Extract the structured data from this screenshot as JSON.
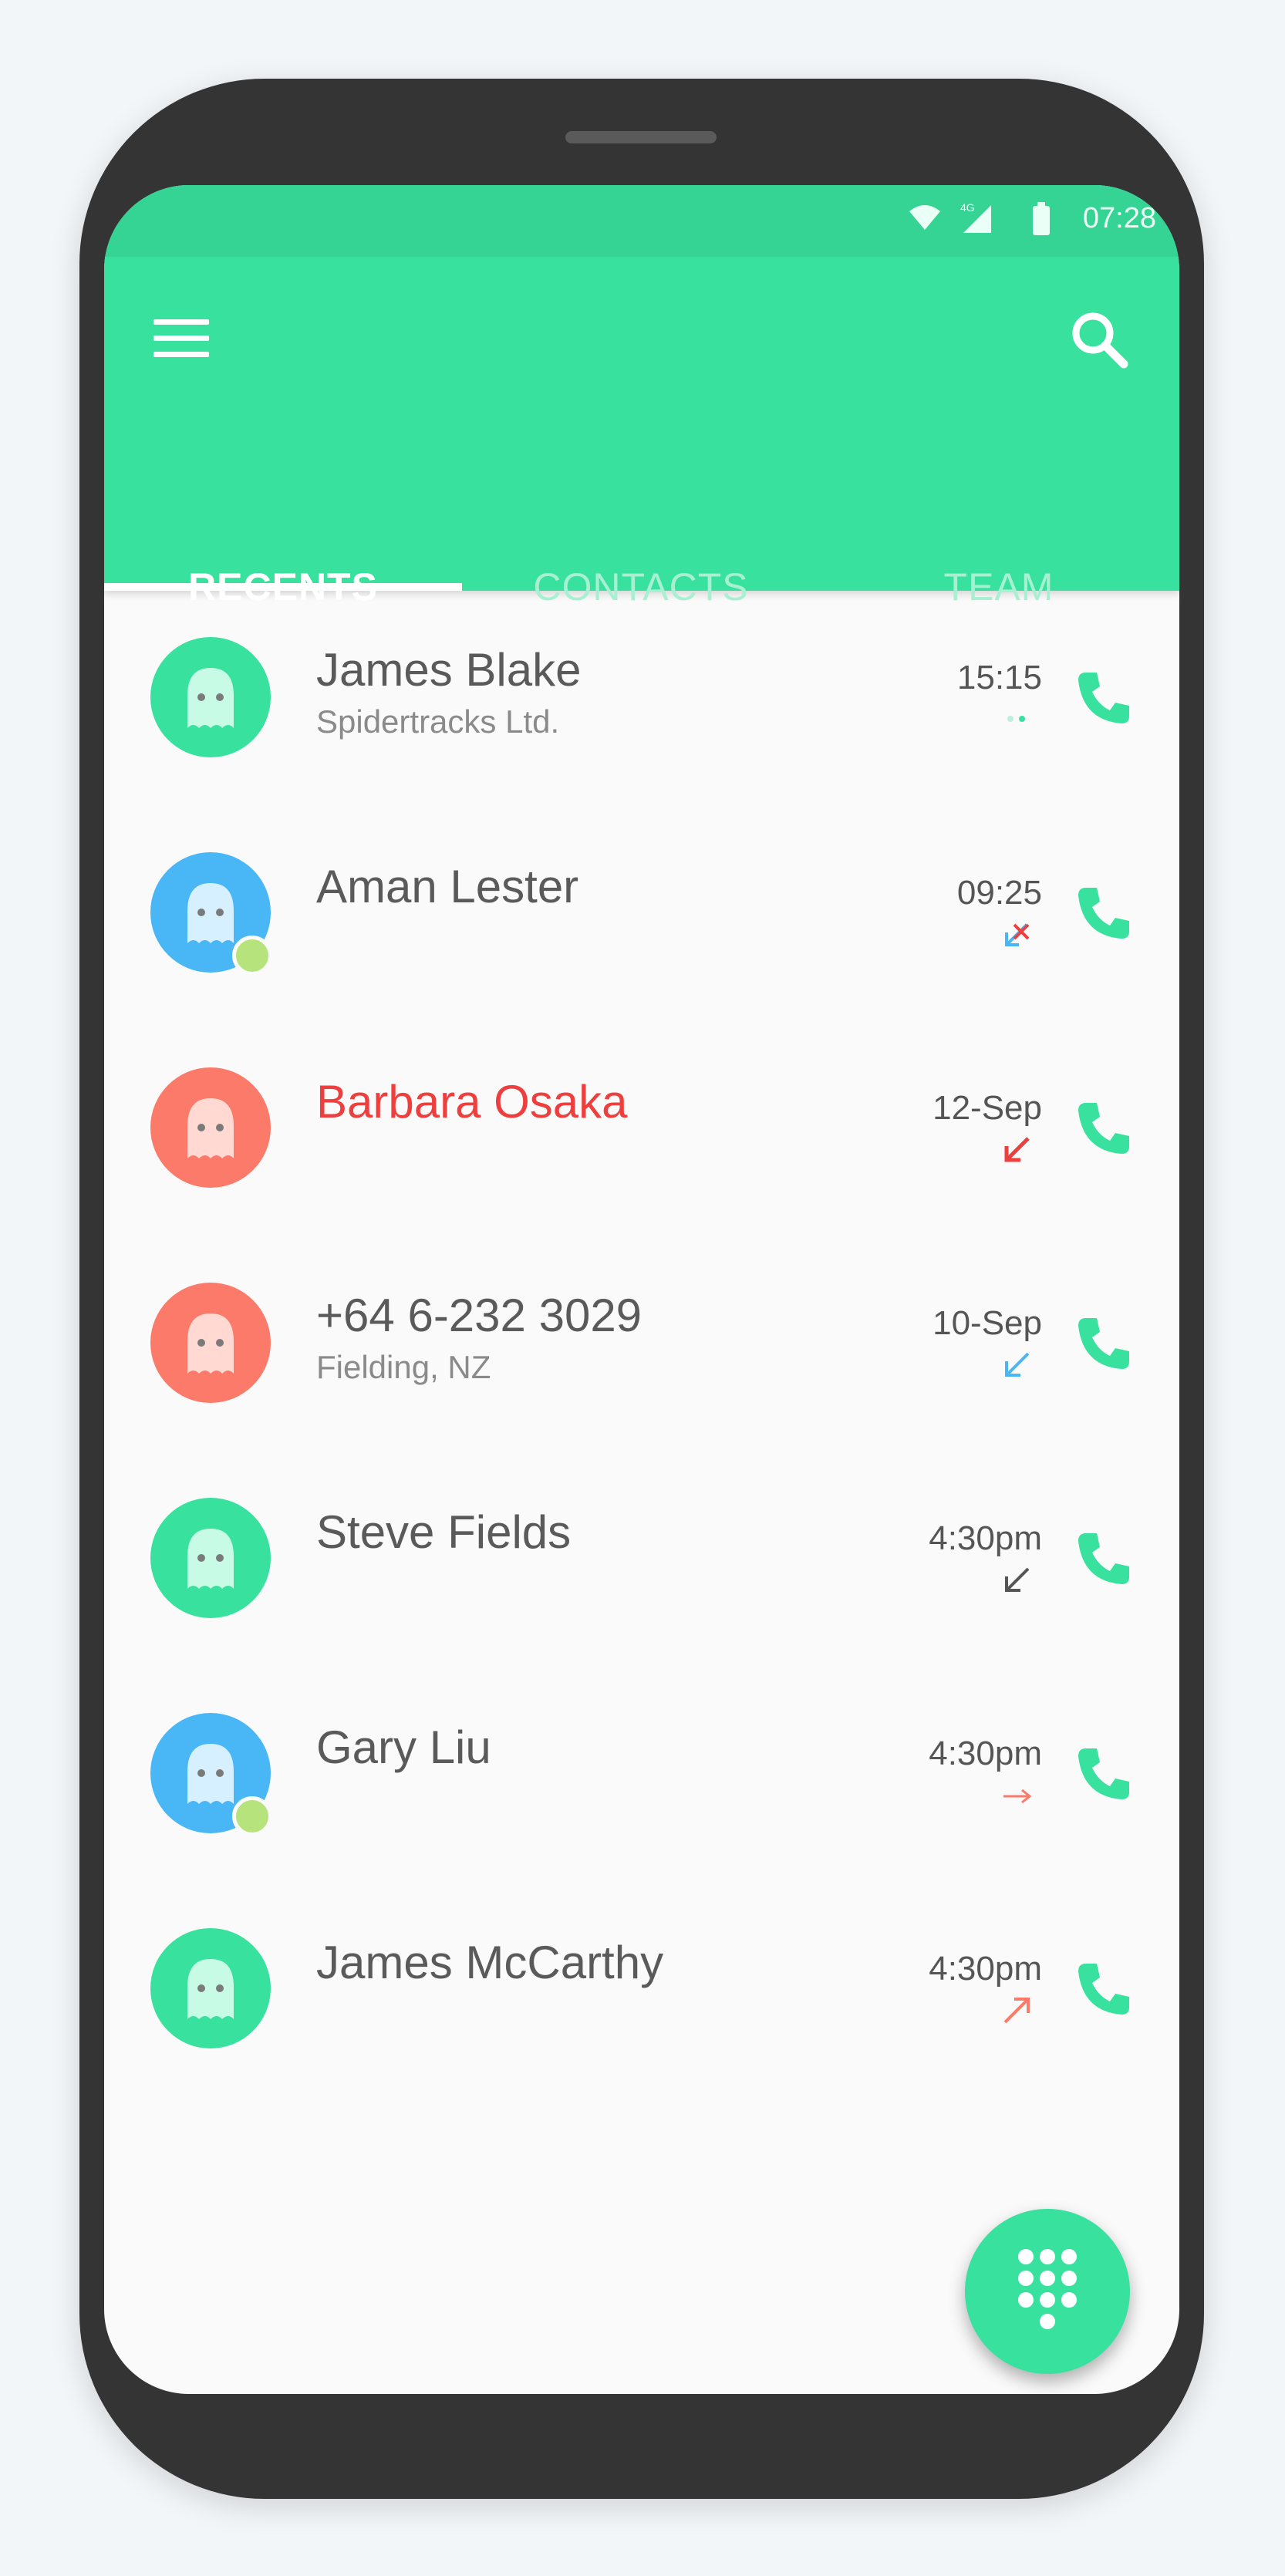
{
  "status_bar": {
    "time": "07:28",
    "network": "4G"
  },
  "tabs": [
    {
      "label": "RECENTS",
      "active": true
    },
    {
      "label": "CONTACTS",
      "active": false
    },
    {
      "label": "TEAM",
      "active": false
    }
  ],
  "calls": [
    {
      "name": "James Blake",
      "subtitle": "Spidertracks Ltd.",
      "time": "15:15",
      "avatar_color": "#38e19e",
      "direction": "ongoing",
      "online": false,
      "name_color": "#5a5a5a"
    },
    {
      "name": "Aman Lester",
      "subtitle": "",
      "time": "09:25",
      "avatar_color": "#49b6f5",
      "direction": "missed-incoming",
      "online": true,
      "name_color": "#5a5a5a"
    },
    {
      "name": "Barbara Osaka",
      "subtitle": "",
      "time": "12-Sep",
      "avatar_color": "#fb7a69",
      "direction": "missed",
      "online": false,
      "name_color": "#ee3f3f"
    },
    {
      "name": "+64 6-232 3029",
      "subtitle": "Fielding, NZ",
      "time": "10-Sep",
      "avatar_color": "#fb7a69",
      "direction": "incoming",
      "online": false,
      "name_color": "#5a5a5a"
    },
    {
      "name": "Steve Fields",
      "subtitle": "",
      "time": "4:30pm",
      "avatar_color": "#38e19e",
      "direction": "incoming-dark",
      "online": false,
      "name_color": "#5a5a5a"
    },
    {
      "name": "Gary Liu",
      "subtitle": "",
      "time": "4:30pm",
      "avatar_color": "#49b6f5",
      "direction": "forwarded",
      "online": true,
      "name_color": "#5a5a5a"
    },
    {
      "name": "James McCarthy",
      "subtitle": "",
      "time": "4:30pm",
      "avatar_color": "#38e19e",
      "direction": "outgoing",
      "online": false,
      "name_color": "#5a5a5a"
    }
  ],
  "colors": {
    "accent": "#38e19e",
    "missed": "#ee3f3f",
    "incoming": "#49b6f5",
    "outgoing": "#fb7a69"
  },
  "icons": {
    "menu": "hamburger-icon",
    "search": "search-icon",
    "call": "phone-icon",
    "fab": "dialpad-icon"
  }
}
